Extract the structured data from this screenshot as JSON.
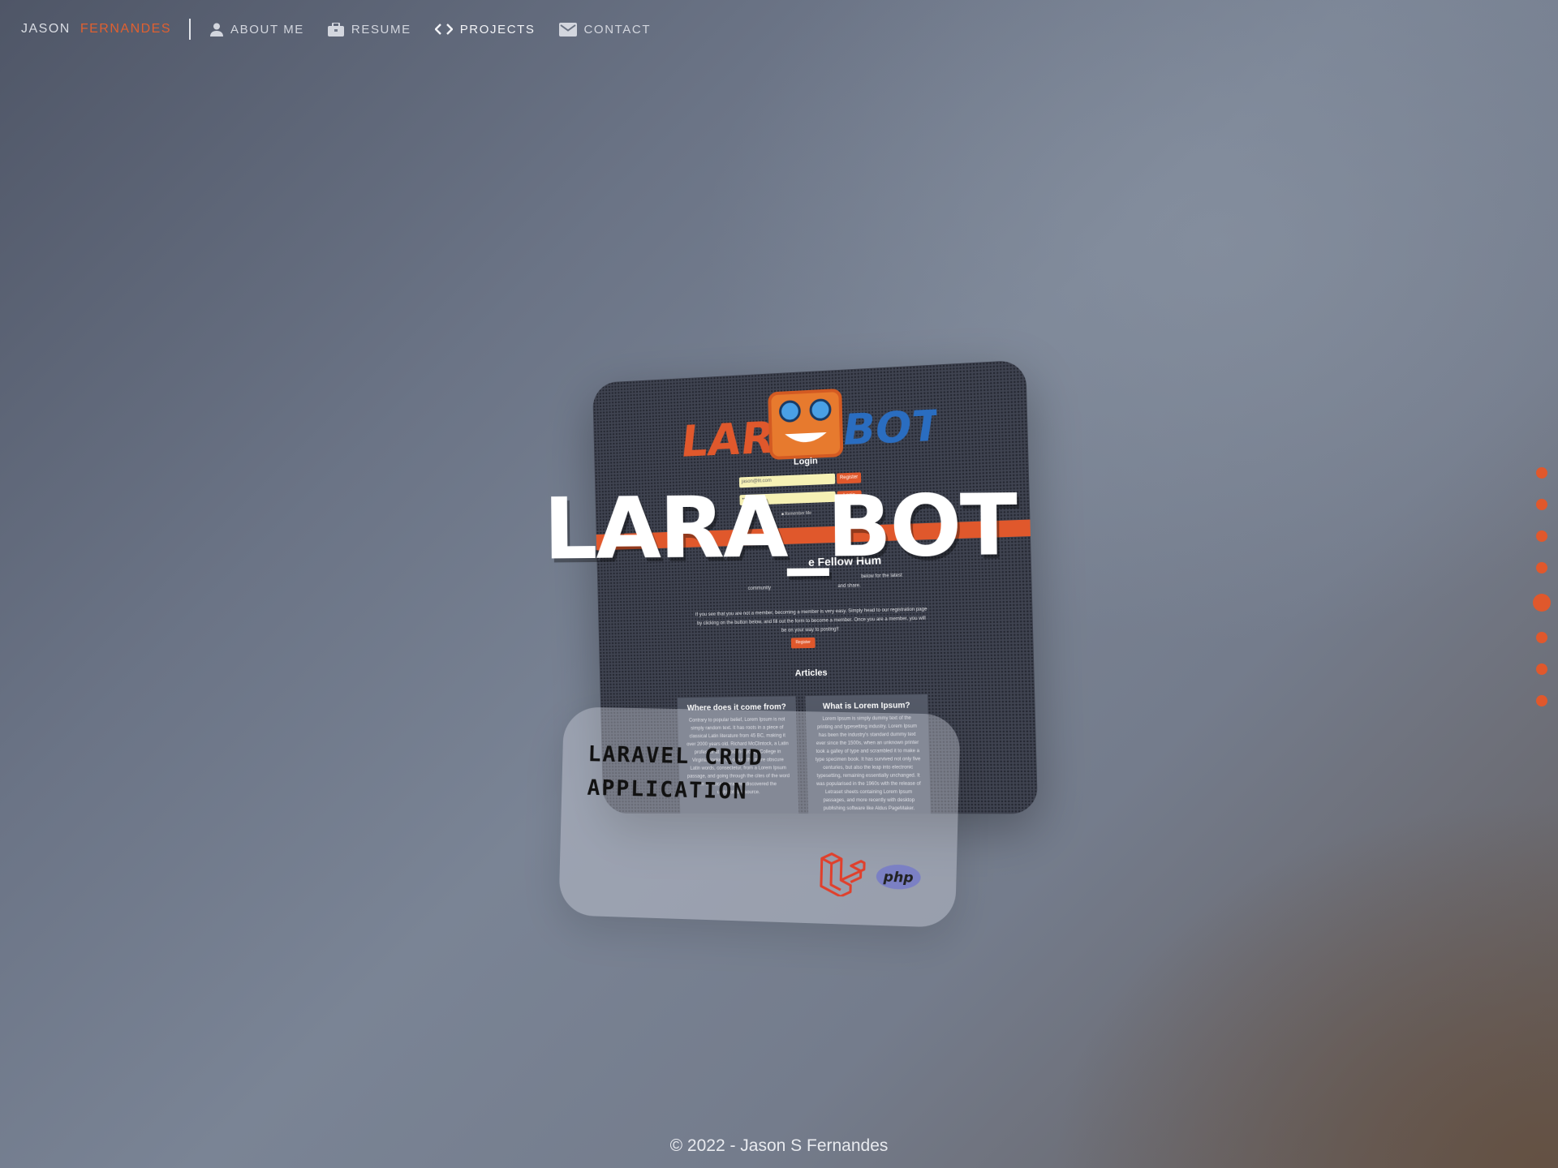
{
  "header": {
    "brand_first": "JASON",
    "brand_last": "FERNANDES",
    "nav": [
      {
        "label": "ABOUT ME",
        "icon": "person-icon"
      },
      {
        "label": "RESUME",
        "icon": "briefcase-icon"
      },
      {
        "label": "PROJECTS",
        "icon": "code-icon"
      },
      {
        "label": "CONTACT",
        "icon": "mail-icon"
      }
    ]
  },
  "project": {
    "title": "LARA_BOT",
    "subtitle": "LARAVEL CRUD APPLICATION",
    "tech": [
      "laravel-icon",
      "php-icon"
    ],
    "screenshot": {
      "logo_left": "LARA",
      "logo_right": "BOT",
      "login_title": "Login",
      "email_value": "jason@lit.com",
      "register_label": "Register",
      "password_value": "••••••",
      "login_label": "Login",
      "remember_label": "Remember Me",
      "welcome_partial": "e Fellow Hum",
      "intro_line1": "below for the latest",
      "intro_line2": "community",
      "intro_line3": "and share.",
      "para_line1": "If you see that you are not a member, becoming a member is very easy. Simply head to our registration page",
      "para_line2": "by clicking on the button below, and fill out the form to become a member. Once you are a member, you will",
      "para_line3": "be on your way to posting!!",
      "register_btn": "Register",
      "articles_heading": "Articles",
      "article1_title": "Where does it come from?",
      "article1_text": "Contrary to popular belief, Lorem Ipsum is not simply random text. It has roots in a piece of classical Latin literature from 45 BC, making it over 2000 years old. Richard McClintock, a Latin professor at Hampden-Sydney College in Virginia, looked up one of the more obscure Latin words, consectetur, from a Lorem Ipsum passage, and going through the cites of the word in classical literature, discovered the undoubtable source.",
      "article2_title": "What is Lorem Ipsum?",
      "article2_text": "Lorem Ipsum is simply dummy text of the printing and typesetting industry. Lorem Ipsum has been the industry's standard dummy text ever since the 1500s, when an unknown printer took a galley of type and scrambled it to make a type specimen book. It has survived not only five centuries, but also the leap into electronic typesetting, remaining essentially unchanged. It was popularised in the 1960s with the release of Letraset sheets containing Lorem Ipsum passages, and more recently with desktop publishing software like Aldus PageMaker."
    }
  },
  "pagination": {
    "total": 8,
    "active": 5
  },
  "colors": {
    "accent": "#e0582c"
  },
  "footer": {
    "text": "© 2022 - Jason S Fernandes"
  }
}
